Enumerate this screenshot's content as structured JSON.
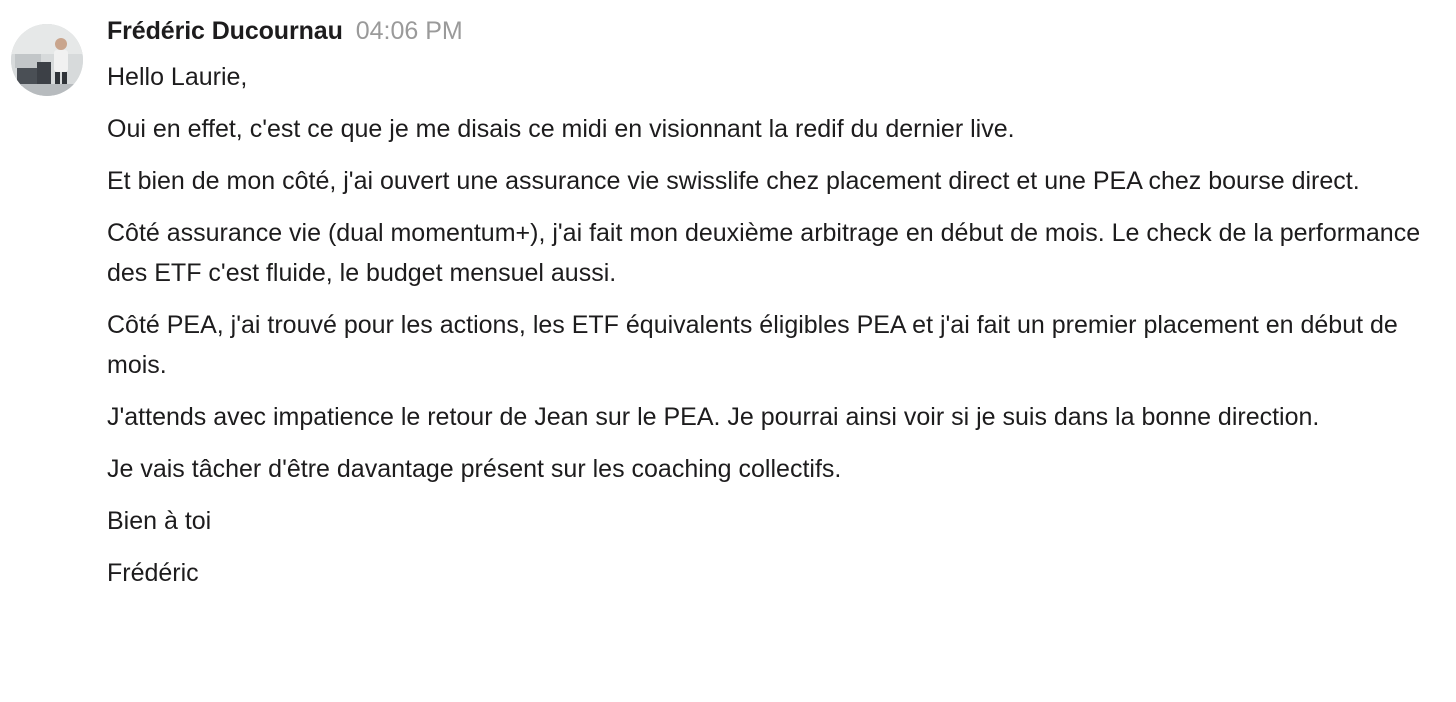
{
  "message": {
    "sender": "Frédéric Ducournau",
    "timestamp": "04:06 PM",
    "avatar_icon": "user-photo-avatar",
    "paragraphs": [
      "Hello Laurie,",
      "Oui en effet, c'est ce que je me disais ce midi en visionnant la redif du dernier live.",
      "Et bien de mon côté, j'ai ouvert une assurance vie swisslife chez placement direct et une PEA chez bourse direct.",
      "Côté assurance vie (dual momentum+), j'ai fait mon deuxième arbitrage en début de mois. Le check de la performance des ETF c'est fluide, le budget mensuel aussi.",
      "Côté PEA, j'ai trouvé pour les actions, les ETF équivalents éligibles PEA et j'ai fait un premier placement en début de mois.",
      "J'attends avec impatience le retour de Jean sur le PEA. Je pourrai ainsi voir si je suis dans la bonne direction.",
      "Je vais tâcher d'être davantage présent sur les coaching collectifs.",
      "Bien à toi",
      "Frédéric"
    ]
  }
}
